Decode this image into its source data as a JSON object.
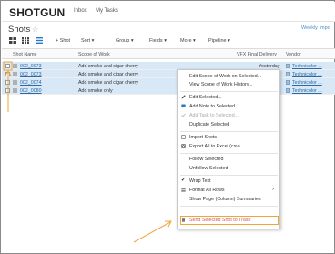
{
  "app": {
    "logo": "SHOTGUN",
    "nav": [
      "Inbox",
      "My Tasks"
    ]
  },
  "page": {
    "title": "Shots",
    "star": "☆",
    "right_link": "Weekly Impo"
  },
  "toolbar": {
    "new_shot": "+ Shot",
    "sort": "Sort ▾",
    "group": "Group ▾",
    "fields": "Fields ▾",
    "more": "More ▾",
    "pipeline": "Pipeline ▾"
  },
  "grid": {
    "columns": [
      "Shot Name",
      "Scope of Work",
      "VFX Final Delivery",
      "Vendor"
    ],
    "rows": [
      {
        "name": "002_0073",
        "scope": "Add smoke and cigar cherry",
        "delivery": "Yesterday",
        "vendor": "Technicolor ..."
      },
      {
        "name": "002_0073",
        "scope": "Add smoke and cigar cherry",
        "delivery": "",
        "vendor": "Technicolor ..."
      },
      {
        "name": "002_0074",
        "scope": "Add smoke and cigar cherry",
        "delivery": "",
        "vendor": "Technicolor ..."
      },
      {
        "name": "002_0080",
        "scope": "Add smoke only",
        "delivery": "",
        "vendor": "Technicolor ..."
      }
    ]
  },
  "context_menu": {
    "items": [
      {
        "label": "Edit Scope of Work on Selected...",
        "disabled": false
      },
      {
        "label": "View Scope of Work History...",
        "disabled": false
      },
      {
        "label": "Edit Selected...",
        "disabled": false
      },
      {
        "label": "Add Note to Selected...",
        "disabled": false
      },
      {
        "label": "Add Task to Selected...",
        "disabled": true
      },
      {
        "label": "Duplicate Selected",
        "disabled": false
      },
      {
        "label": "Import Shots",
        "disabled": false
      },
      {
        "label": "Export All to Excel (csv)",
        "disabled": false
      },
      {
        "label": "Follow Selected",
        "disabled": false
      },
      {
        "label": "Unfollow Selected",
        "disabled": false
      },
      {
        "label": "Wrap Text",
        "disabled": false
      },
      {
        "label": "Format All Rows",
        "disabled": false
      },
      {
        "label": "Show Page (Column) Summaries",
        "disabled": false
      },
      {
        "label": "Send Selected Shot to Trash",
        "disabled": false
      }
    ],
    "submenu_arrow": "›",
    "check": "✔"
  },
  "colors": {
    "accent_link": "#2a6aa6",
    "selected_row": "#d8e8f6",
    "annotation": "#f0a53a",
    "trash_text": "#d9534f"
  }
}
